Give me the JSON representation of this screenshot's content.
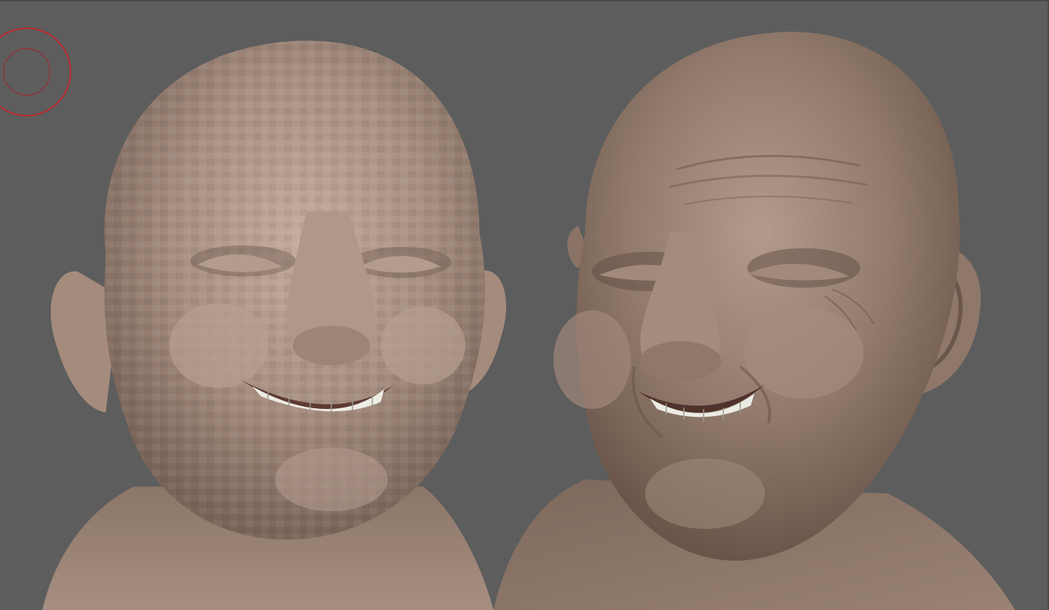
{
  "viewport": {
    "background_color": "#5d5d5d",
    "clay_color": "#9c8576",
    "brush_ring_color": "#c0262b"
  },
  "icons": {
    "brush": "brush-cursor-icon"
  },
  "models": [
    {
      "id": "lowpoly",
      "description_name": "lowpoly-head-sculpt"
    },
    {
      "id": "detailed",
      "description_name": "detailed-head-sculpt"
    }
  ]
}
